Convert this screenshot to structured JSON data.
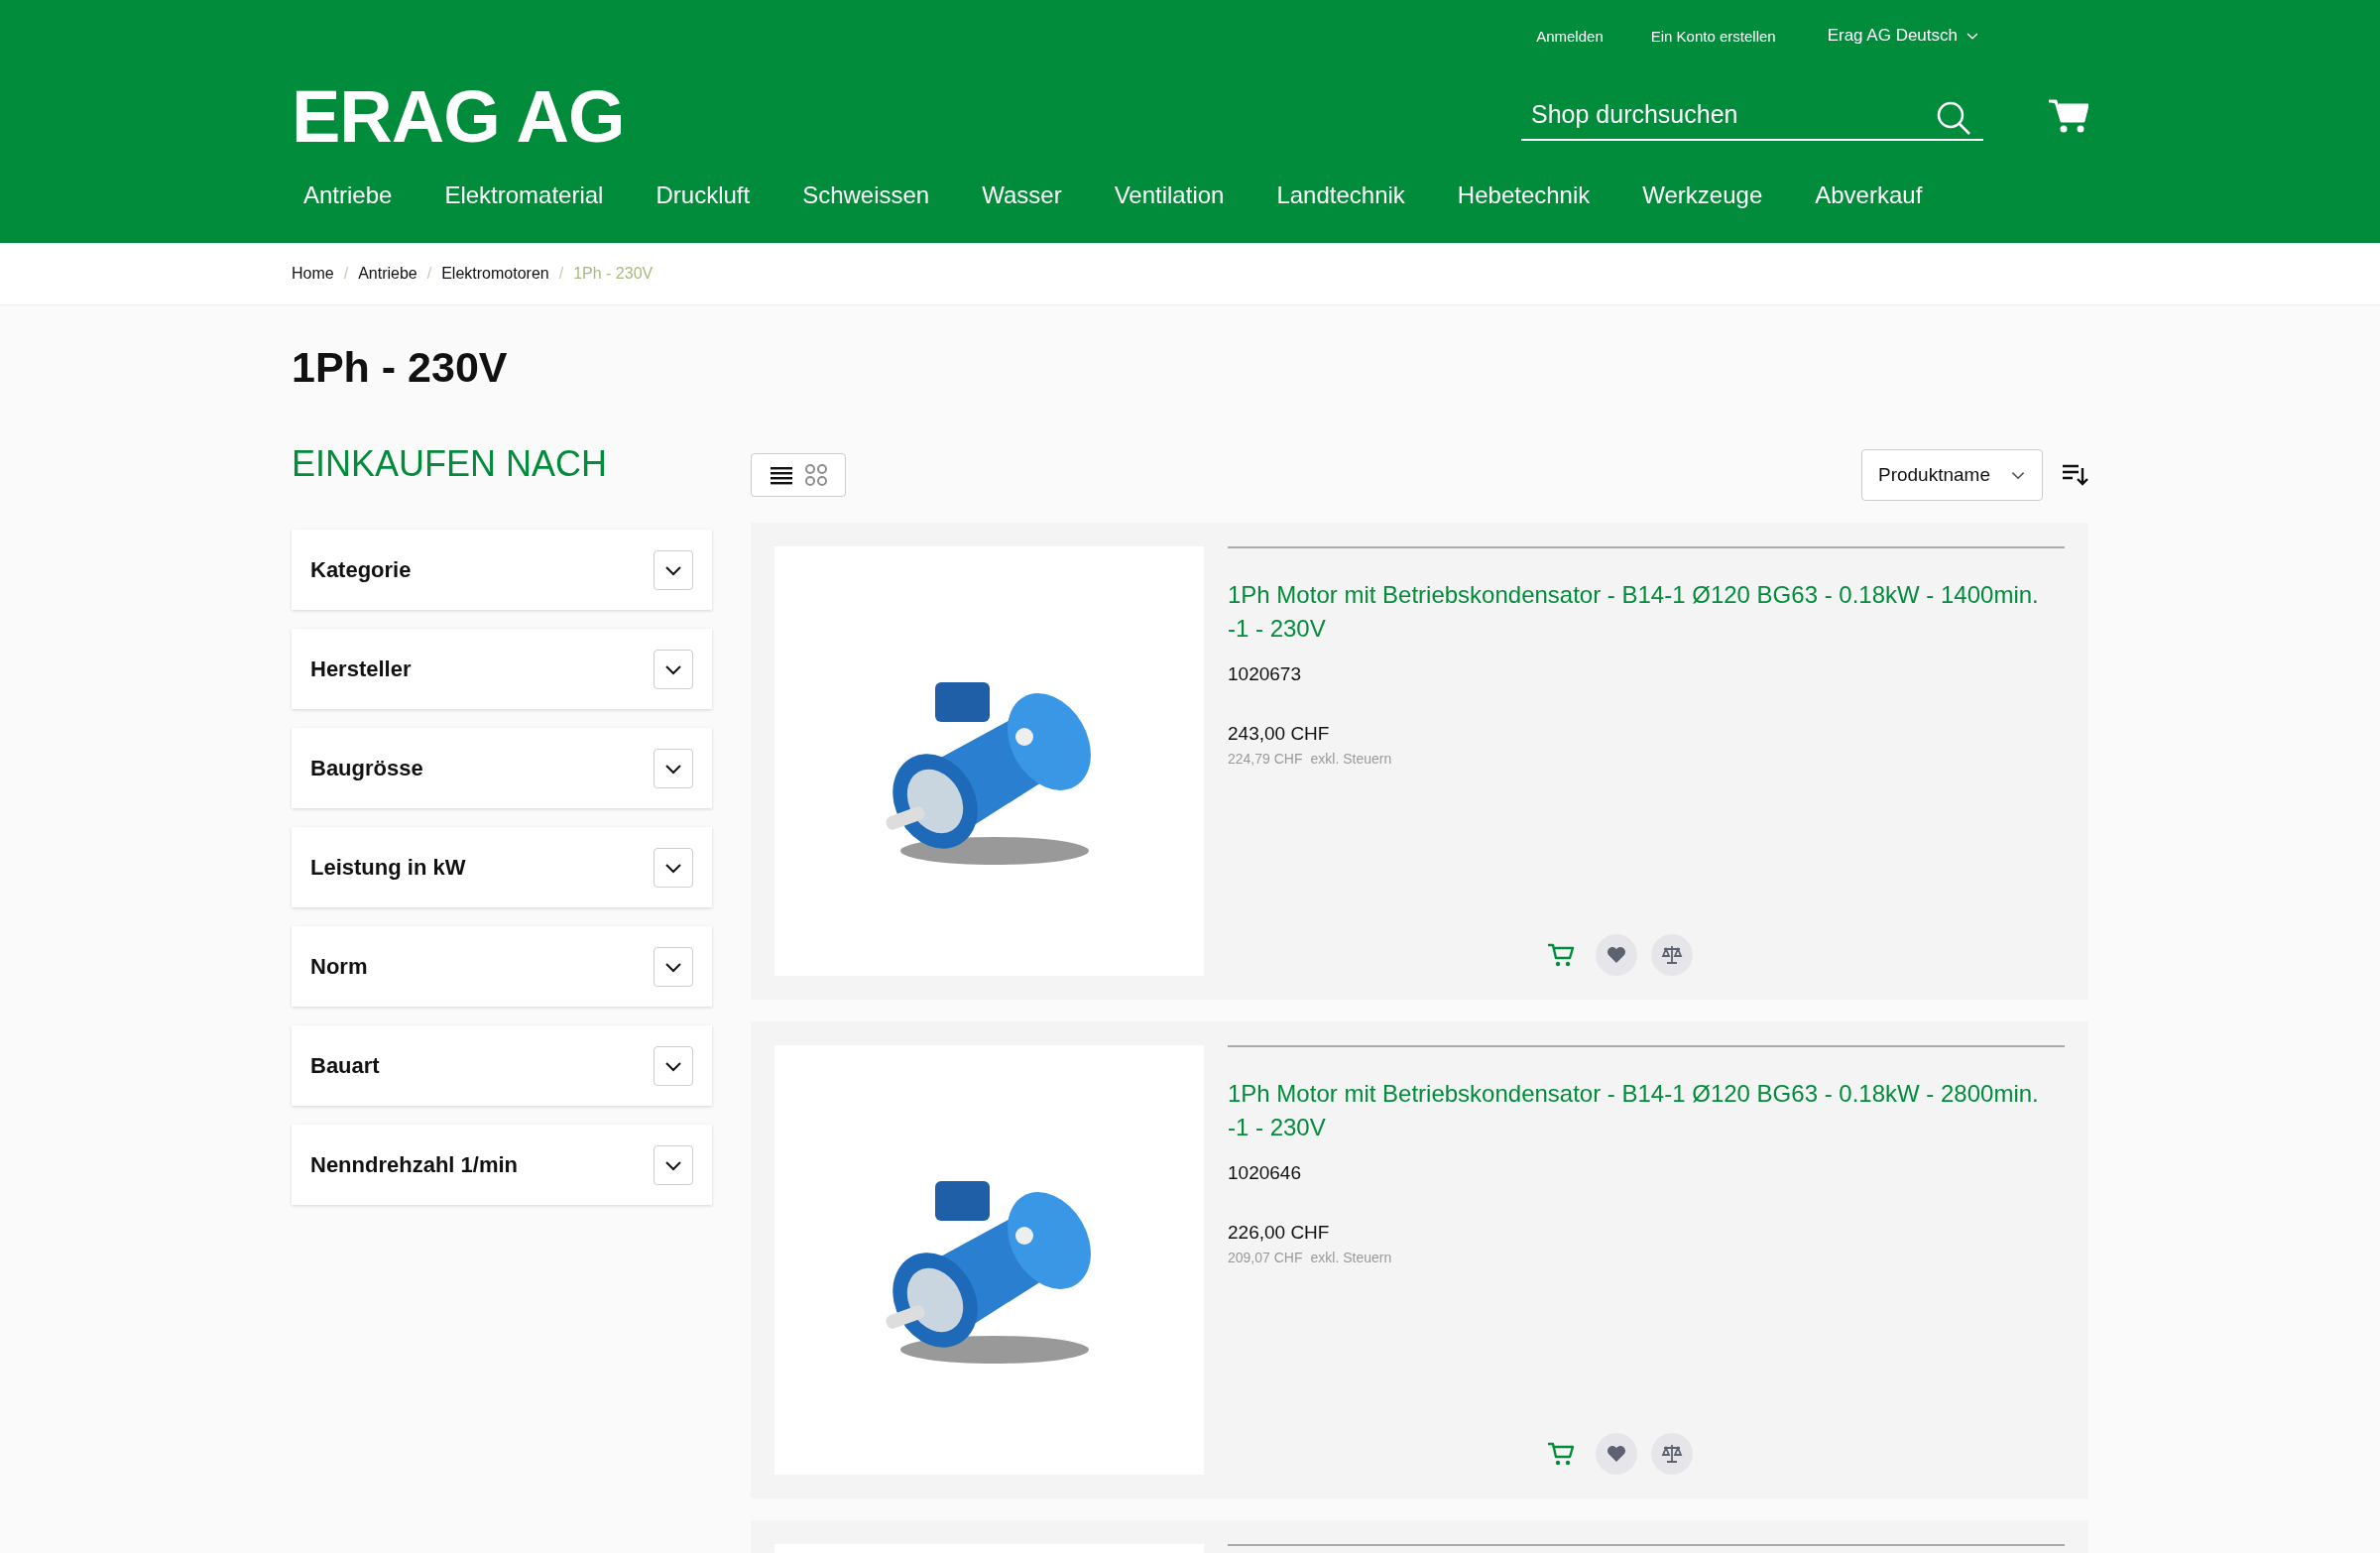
{
  "header": {
    "top_links": [
      "Anmelden",
      "Ein Konto erstellen"
    ],
    "language": "Erag AG Deutsch",
    "logo": "ERAG AG",
    "search": {
      "placeholder": "Shop durchsuchen"
    },
    "nav": [
      "Antriebe",
      "Elektromaterial",
      "Druckluft",
      "Schweissen",
      "Wasser",
      "Ventilation",
      "Landtechnik",
      "Hebetechnik",
      "Werkzeuge",
      "Abverkauf"
    ]
  },
  "breadcrumb_separator": "/",
  "breadcrumb": [
    {
      "label": "Home",
      "current": false
    },
    {
      "label": "Antriebe",
      "current": false
    },
    {
      "label": "Elektromotoren",
      "current": false
    },
    {
      "label": "1Ph - 230V",
      "current": true
    }
  ],
  "page_title": "1Ph - 230V",
  "sidebar": {
    "title": "EINKAUFEN NACH",
    "filters": [
      {
        "label": "Kategorie",
        "expanded": false
      },
      {
        "label": "Hersteller",
        "expanded": false
      },
      {
        "label": "Baugrösse",
        "expanded": false
      },
      {
        "label": "Leistung in kW",
        "expanded": false
      },
      {
        "label": "Norm",
        "expanded": false
      },
      {
        "label": "Bauart",
        "expanded": false
      },
      {
        "label": "Nenndrehzahl 1/min",
        "expanded": false
      }
    ]
  },
  "toolbar": {
    "views": [
      {
        "kind": "list",
        "selected": true
      },
      {
        "kind": "grid",
        "selected": false
      }
    ],
    "sort": "Produktname"
  },
  "products": [
    {
      "name": "1Ph Motor mit Betriebskondensator - B14-1 Ø120 BG63 - 0.18kW - 1400min.-1 - 230V",
      "sku": "1020673",
      "price": "243,00 CHF",
      "net_price": "224,79 CHF",
      "net_label": "exkl. Steuern"
    },
    {
      "name": "1Ph Motor mit Betriebskondensator - B14-1 Ø120 BG63 - 0.18kW - 2800min.-1 - 230V",
      "sku": "1020646",
      "price": "226,00 CHF",
      "net_price": "209,07 CHF",
      "net_label": "exkl. Steuern"
    }
  ]
}
